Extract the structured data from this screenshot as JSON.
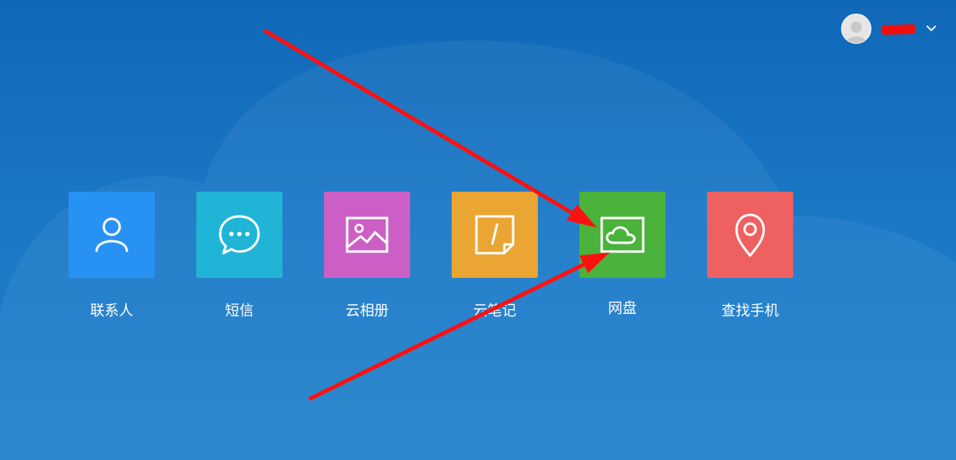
{
  "header": {
    "username": "",
    "avatar_icon": "user-avatar-icon",
    "dropdown_icon": "chevron-down-icon"
  },
  "apps": [
    {
      "label": "联系人",
      "icon": "person-icon",
      "color": "#2792f3"
    },
    {
      "label": "短信",
      "icon": "chat-bubble-icon",
      "color": "#20b4d6"
    },
    {
      "label": "云相册",
      "icon": "photo-icon",
      "color": "#cc5fc6"
    },
    {
      "label": "云笔记",
      "icon": "note-icon",
      "color": "#eaa532"
    },
    {
      "label": "网盘",
      "icon": "cloud-drive-icon",
      "color": "#4bb23b"
    },
    {
      "label": "查找手机",
      "icon": "location-pin-icon",
      "color": "#ef6061"
    }
  ],
  "annotation": {
    "arrow_color": "#ff1010"
  }
}
